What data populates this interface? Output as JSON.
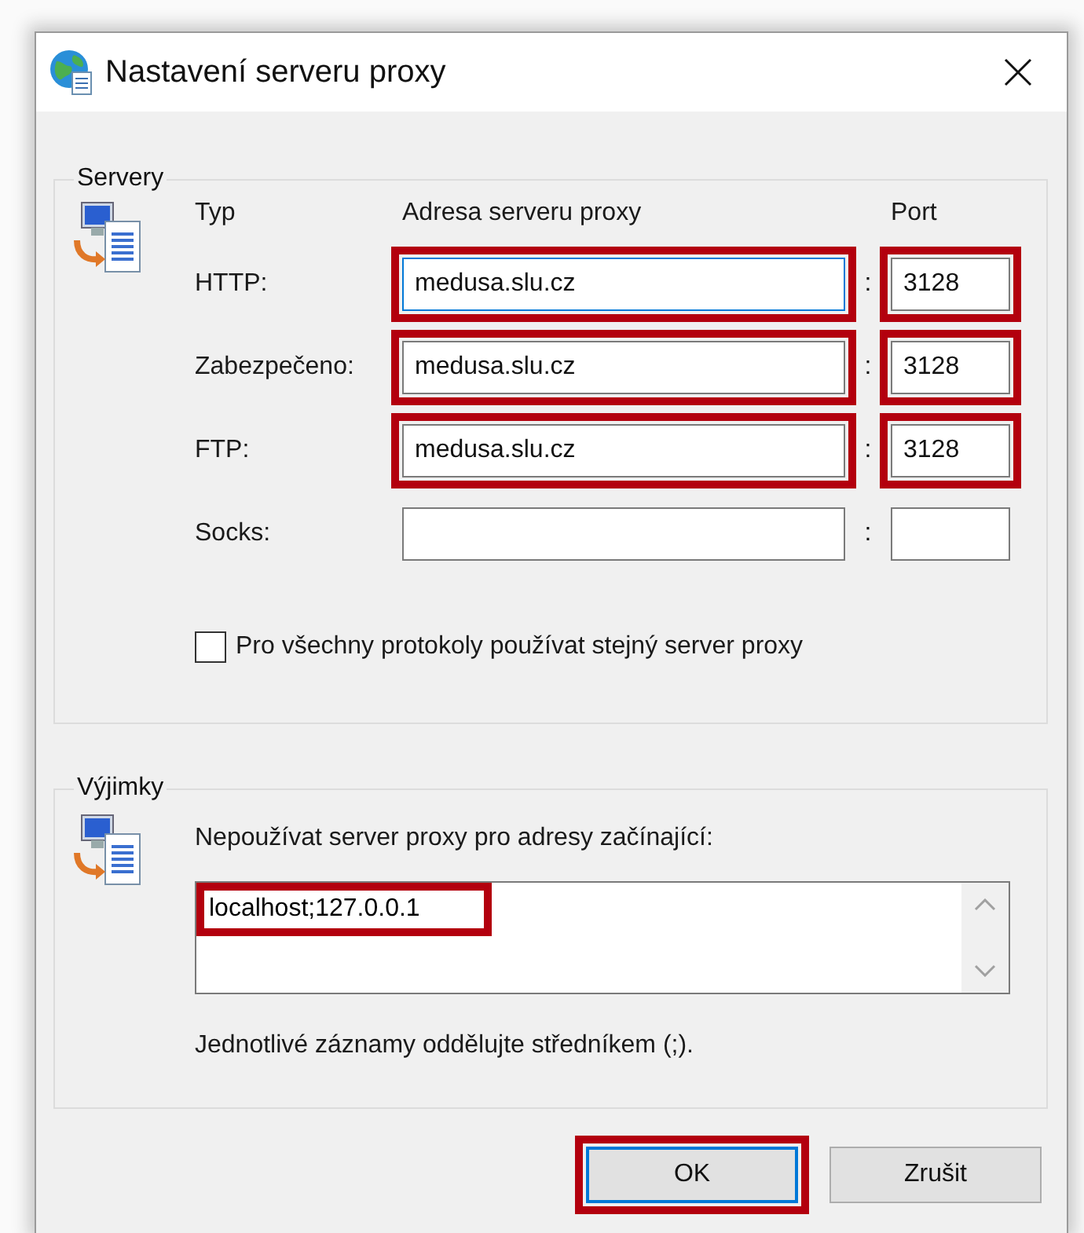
{
  "window": {
    "title": "Nastavení serveru proxy"
  },
  "servers": {
    "title": "Servery",
    "headers": {
      "type": "Typ",
      "address": "Adresa serveru proxy",
      "port": "Port"
    },
    "rows": [
      {
        "label": "HTTP:",
        "address": "medusa.slu.cz",
        "port": "3128",
        "focused": true,
        "address_highlighted": true,
        "port_highlighted": true
      },
      {
        "label": "Zabezpečeno:",
        "address": "medusa.slu.cz",
        "port": "3128",
        "focused": false,
        "address_highlighted": true,
        "port_highlighted": true
      },
      {
        "label": "FTP:",
        "address": "medusa.slu.cz",
        "port": "3128",
        "focused": false,
        "address_highlighted": true,
        "port_highlighted": true
      },
      {
        "label": "Socks:",
        "address": "",
        "port": "",
        "focused": false,
        "address_highlighted": false,
        "port_highlighted": false
      }
    ],
    "separator": ":",
    "same_proxy": {
      "label": "Pro všechny protokoly používat stejný server proxy",
      "checked": false
    }
  },
  "exceptions": {
    "title": "Výjimky",
    "label": "Nepoužívat server proxy pro adresy začínající:",
    "value": "localhost;127.0.0.1",
    "highlighted": true,
    "hint": "Jednotlivé záznamy oddělujte středníkem (;)."
  },
  "buttons": [
    {
      "label": "OK",
      "default": true,
      "highlighted": true
    },
    {
      "label": "Zrušit",
      "default": false,
      "highlighted": false
    }
  ]
}
